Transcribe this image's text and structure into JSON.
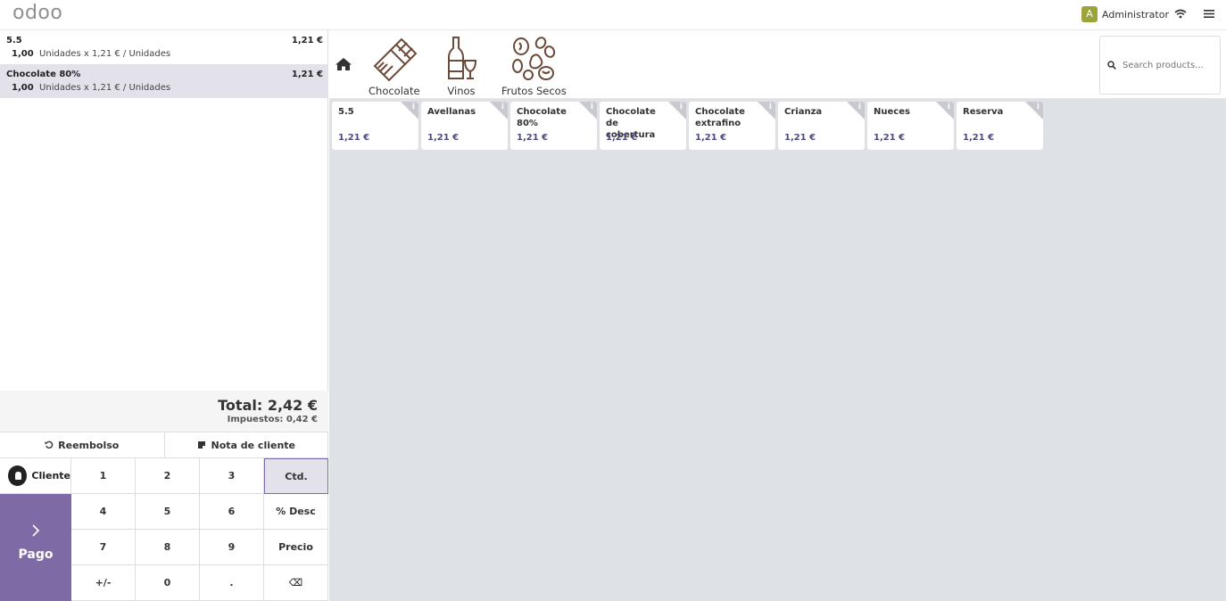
{
  "header": {
    "logo": "odoo",
    "user_initial": "A",
    "user_name": "Administrator"
  },
  "order": {
    "lines": [
      {
        "name": "5.5",
        "price": "1,21 €",
        "qty": "1,00",
        "detail": "Unidades x 1,21 € / Unidades"
      },
      {
        "name": "Chocolate 80%",
        "price": "1,21 €",
        "qty": "1,00",
        "detail": "Unidades x 1,21 € / Unidades"
      }
    ],
    "total": "Total: 2,42 €",
    "taxes": "Impuestos: 0,42 €"
  },
  "actions": {
    "refund": "Reembolso",
    "note": "Nota de cliente"
  },
  "numpad": {
    "customer": "Cliente",
    "pay": "Pago",
    "keys": [
      "1",
      "2",
      "3",
      "Ctd.",
      "4",
      "5",
      "6",
      "% Desc",
      "7",
      "8",
      "9",
      "Precio",
      "+/-",
      "0",
      ".",
      "⌫"
    ],
    "active_key": "Ctd."
  },
  "categories": [
    {
      "label": "Chocolate"
    },
    {
      "label": "Vinos"
    },
    {
      "label": "Frutos Secos"
    }
  ],
  "search": {
    "placeholder": "Search products..."
  },
  "products": [
    {
      "name": "5.5",
      "price": "1,21 €"
    },
    {
      "name": "Avellanas",
      "price": "1,21 €"
    },
    {
      "name": "Chocolate 80%",
      "price": "1,21 €"
    },
    {
      "name": "Chocolate de cobertura",
      "price": "1,21 €"
    },
    {
      "name": "Chocolate extrafino",
      "price": "1,21 €"
    },
    {
      "name": "Crianza",
      "price": "1,21 €"
    },
    {
      "name": "Nueces",
      "price": "1,21 €"
    },
    {
      "name": "Reserva",
      "price": "1,21 €"
    }
  ],
  "colors": {
    "accent": "#7e6ba5",
    "selected_row": "#e3e1ea",
    "product_area": "#dee1e5",
    "avatar": "#9ca33a"
  }
}
